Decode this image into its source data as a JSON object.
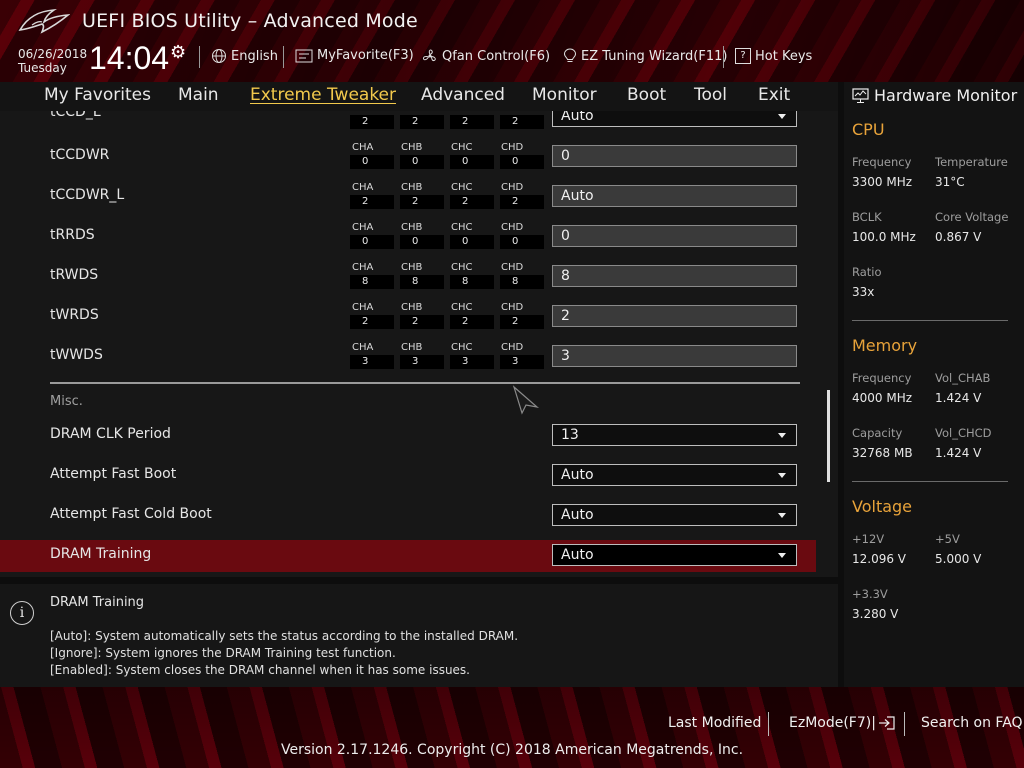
{
  "header": {
    "title": "UEFI BIOS Utility – Advanced Mode",
    "date": "06/26/2018",
    "day": "Tuesday",
    "time": "14:04",
    "toolbar": {
      "language": "English",
      "favorite": "MyFavorite(F3)",
      "qfan": "Qfan Control(F6)",
      "ez_tuning": "EZ Tuning Wizard(F11)",
      "hotkeys": "Hot Keys",
      "hotkeys_key": "?"
    }
  },
  "menu": {
    "items": [
      "My Favorites",
      "Main",
      "Extreme Tweaker",
      "Advanced",
      "Monitor",
      "Boot",
      "Tool",
      "Exit"
    ],
    "active": "Extreme Tweaker"
  },
  "channels": [
    "CHA",
    "CHB",
    "CHC",
    "CHD"
  ],
  "timings": [
    {
      "label": "tCCD_L",
      "values": [
        "2",
        "2",
        "2",
        "2"
      ],
      "setting": "Auto",
      "type": "select"
    },
    {
      "label": "tCCDWR",
      "values": [
        "0",
        "0",
        "0",
        "0"
      ],
      "setting": "0",
      "type": "input"
    },
    {
      "label": "tCCDWR_L",
      "values": [
        "2",
        "2",
        "2",
        "2"
      ],
      "setting": "Auto",
      "type": "input"
    },
    {
      "label": "tRRDS",
      "values": [
        "0",
        "0",
        "0",
        "0"
      ],
      "setting": "0",
      "type": "input"
    },
    {
      "label": "tRWDS",
      "values": [
        "8",
        "8",
        "8",
        "8"
      ],
      "setting": "8",
      "type": "input"
    },
    {
      "label": "tWRDS",
      "values": [
        "2",
        "2",
        "2",
        "2"
      ],
      "setting": "2",
      "type": "input"
    },
    {
      "label": "tWWDS",
      "values": [
        "3",
        "3",
        "3",
        "3"
      ],
      "setting": "3",
      "type": "input"
    }
  ],
  "misc": {
    "label": "Misc.",
    "items": [
      {
        "label": "DRAM CLK Period",
        "value": "13"
      },
      {
        "label": "Attempt Fast Boot",
        "value": "Auto"
      },
      {
        "label": "Attempt Fast Cold Boot",
        "value": "Auto"
      },
      {
        "label": "DRAM Training",
        "value": "Auto"
      }
    ],
    "selected_index": 3
  },
  "help": {
    "title": "DRAM Training",
    "lines": [
      "[Auto]: System automatically sets the status according to the installed DRAM.",
      "[Ignore]: System ignores the DRAM Training test function.",
      "[Enabled]: System closes the DRAM channel when it has some issues."
    ]
  },
  "hw_monitor": {
    "title": "Hardware Monitor",
    "cpu": {
      "label": "CPU",
      "frequency_label": "Frequency",
      "frequency": "3300 MHz",
      "temperature_label": "Temperature",
      "temperature": "31°C",
      "bclk_label": "BCLK",
      "bclk": "100.0 MHz",
      "core_voltage_label": "Core Voltage",
      "core_voltage": "0.867 V",
      "ratio_label": "Ratio",
      "ratio": "33x"
    },
    "memory": {
      "label": "Memory",
      "frequency_label": "Frequency",
      "frequency": "4000 MHz",
      "vol_chab_label": "Vol_CHAB",
      "vol_chab": "1.424 V",
      "capacity_label": "Capacity",
      "capacity": "32768 MB",
      "vol_chcd_label": "Vol_CHCD",
      "vol_chcd": "1.424 V"
    },
    "voltage": {
      "label": "Voltage",
      "v12_label": "+12V",
      "v12": "12.096 V",
      "v5_label": "+5V",
      "v5": "5.000 V",
      "v33_label": "+3.3V",
      "v33": "3.280 V"
    }
  },
  "footer": {
    "last_modified": "Last Modified",
    "ezmode": "EzMode(F7)|",
    "search_faq": "Search on FAQ",
    "version": "Version 2.17.1246. Copyright (C) 2018 American Megatrends, Inc."
  },
  "colors": {
    "accent": "#f2c94c",
    "hw_section": "#e8a33a",
    "selected_row": "#6a0a10",
    "brand_red": "#400006"
  }
}
